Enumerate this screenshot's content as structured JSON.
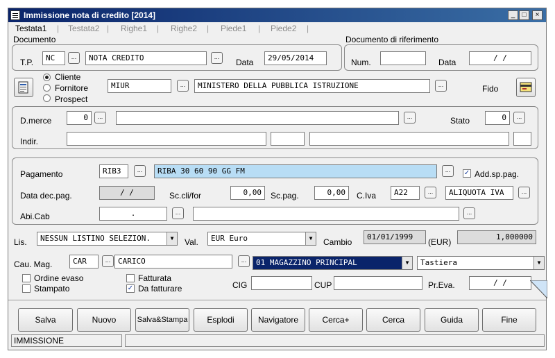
{
  "window": {
    "title": "Immissione nota di credito [2014]",
    "minimize": "_",
    "maximize": "□",
    "close": "×"
  },
  "tabs": [
    "Testata1",
    "Testata2",
    "Righe1",
    "Righe2",
    "Piede1",
    "Piede2"
  ],
  "tab_separator": "|",
  "documento": {
    "group_label": "Documento",
    "tp_label": "T.P.",
    "tp_code": "NC",
    "tp_desc": "NOTA CREDITO",
    "data_label": "Data",
    "data_value": "29/05/2014"
  },
  "riferimento": {
    "group_label": "Documento di riferimento",
    "num_label": "Num.",
    "num_value": "",
    "data_label": "Data",
    "data_value": " /  /"
  },
  "soggetto": {
    "options": [
      "Cliente",
      "Fornitore",
      "Prospect"
    ],
    "selected": "Cliente",
    "code": "MIUR",
    "desc": "MINISTERO DELLA PUBBLICA ISTRUZIONE",
    "fido_label": "Fido"
  },
  "destinazione": {
    "dmerce_label": "D.merce",
    "dmerce_code": "0",
    "dmerce_desc": "",
    "stato_label": "Stato",
    "stato_value": "0",
    "indir_label": "Indir.",
    "indir_value": "",
    "cap_value": "",
    "citta_value": "",
    "prov_value": ""
  },
  "pagamento": {
    "label": "Pagamento",
    "code": "RIB3",
    "desc": "RIBA 30 60 90 GG FM",
    "add_sp_label": "Add.sp.pag.",
    "add_sp_checked": true,
    "data_dec_label": "Data dec.pag.",
    "data_dec_value": " /  /",
    "sc_cli_label": "Sc.cli/for",
    "sc_cli_value": "0,00",
    "sc_pag_label": "Sc.pag.",
    "sc_pag_value": "0,00",
    "civa_label": "C.Iva",
    "civa_code": "A22",
    "civa_desc": "ALIQUOTA IVA",
    "abicab_label": "Abi.Cab",
    "abicab_value": ".",
    "abicab_desc": ""
  },
  "listino": {
    "lis_label": "Lis.",
    "lis_value": "NESSUN LISTINO SELEZION.",
    "val_label": "Val.",
    "val_value": "EUR  Euro",
    "cambio_label": "Cambio",
    "cambio_date": "01/01/1999",
    "cambio_currency": "(EUR)",
    "cambio_value": "1,000000"
  },
  "magazzino": {
    "cau_label": "Cau. Mag.",
    "cau_code": "CAR",
    "cau_desc": "CARICO",
    "mag_value": "01   MAGAZZINO PRINCIPAL",
    "input_mode": "Tastiera"
  },
  "flags": {
    "ordine_evaso": "Ordine evaso",
    "ordine_evaso_checked": false,
    "stampato": "Stampato",
    "stampato_checked": false,
    "fatturata": "Fatturata",
    "fatturata_checked": false,
    "da_fatturare": "Da fatturare",
    "da_fatturare_checked": true,
    "check_mark": "✓",
    "cig_label": "CIG",
    "cig_value": "",
    "cup_label": "CUP",
    "cup_value": "",
    "preva_label": "Pr.Eva.",
    "preva_value": " /  /"
  },
  "buttons": [
    "Salva",
    "Nuovo",
    "Salva&Stampa",
    "Esplodi",
    "Navigatore",
    "Cerca+",
    "Cerca",
    "Guida",
    "Fine"
  ],
  "dots_label": "...",
  "dropdown_arrow": "▼",
  "status": {
    "mode": "IMMISSIONE",
    "message": ""
  }
}
